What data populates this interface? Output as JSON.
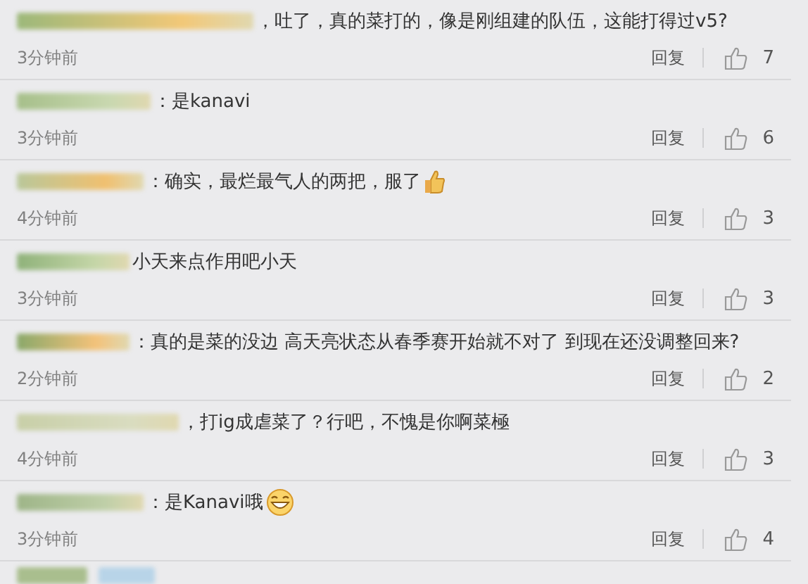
{
  "comments": [
    {
      "kind": "plain",
      "text": "，吐了，真的菜打的，像是刚组建的队伍，这能打得过v5?",
      "time": "3分钟前",
      "reply": "回复",
      "likes": "7"
    },
    {
      "kind": "plain",
      "text": "：是kanavi",
      "time": "3分钟前",
      "reply": "回复",
      "likes": "6"
    },
    {
      "kind": "thumbs",
      "text": "：确实，最烂最气人的两把，服了",
      "time": "4分钟前",
      "reply": "回复",
      "likes": "3"
    },
    {
      "kind": "plain",
      "text": "小天来点作用吧小天",
      "time": "3分钟前",
      "reply": "回复",
      "likes": "3"
    },
    {
      "kind": "plain",
      "text": "：真的是菜的没边 高天亮状态从春季赛开始就不对了 到现在还没调整回来?",
      "time": "2分钟前",
      "reply": "回复",
      "likes": "2"
    },
    {
      "kind": "plain",
      "text": "，打ig成虐菜了？行吧，不愧是你啊菜極",
      "time": "4分钟前",
      "reply": "回复",
      "likes": "3"
    },
    {
      "kind": "grin",
      "text": "：是Kanavi哦",
      "time": "3分钟前",
      "reply": "回复",
      "likes": "4"
    }
  ]
}
